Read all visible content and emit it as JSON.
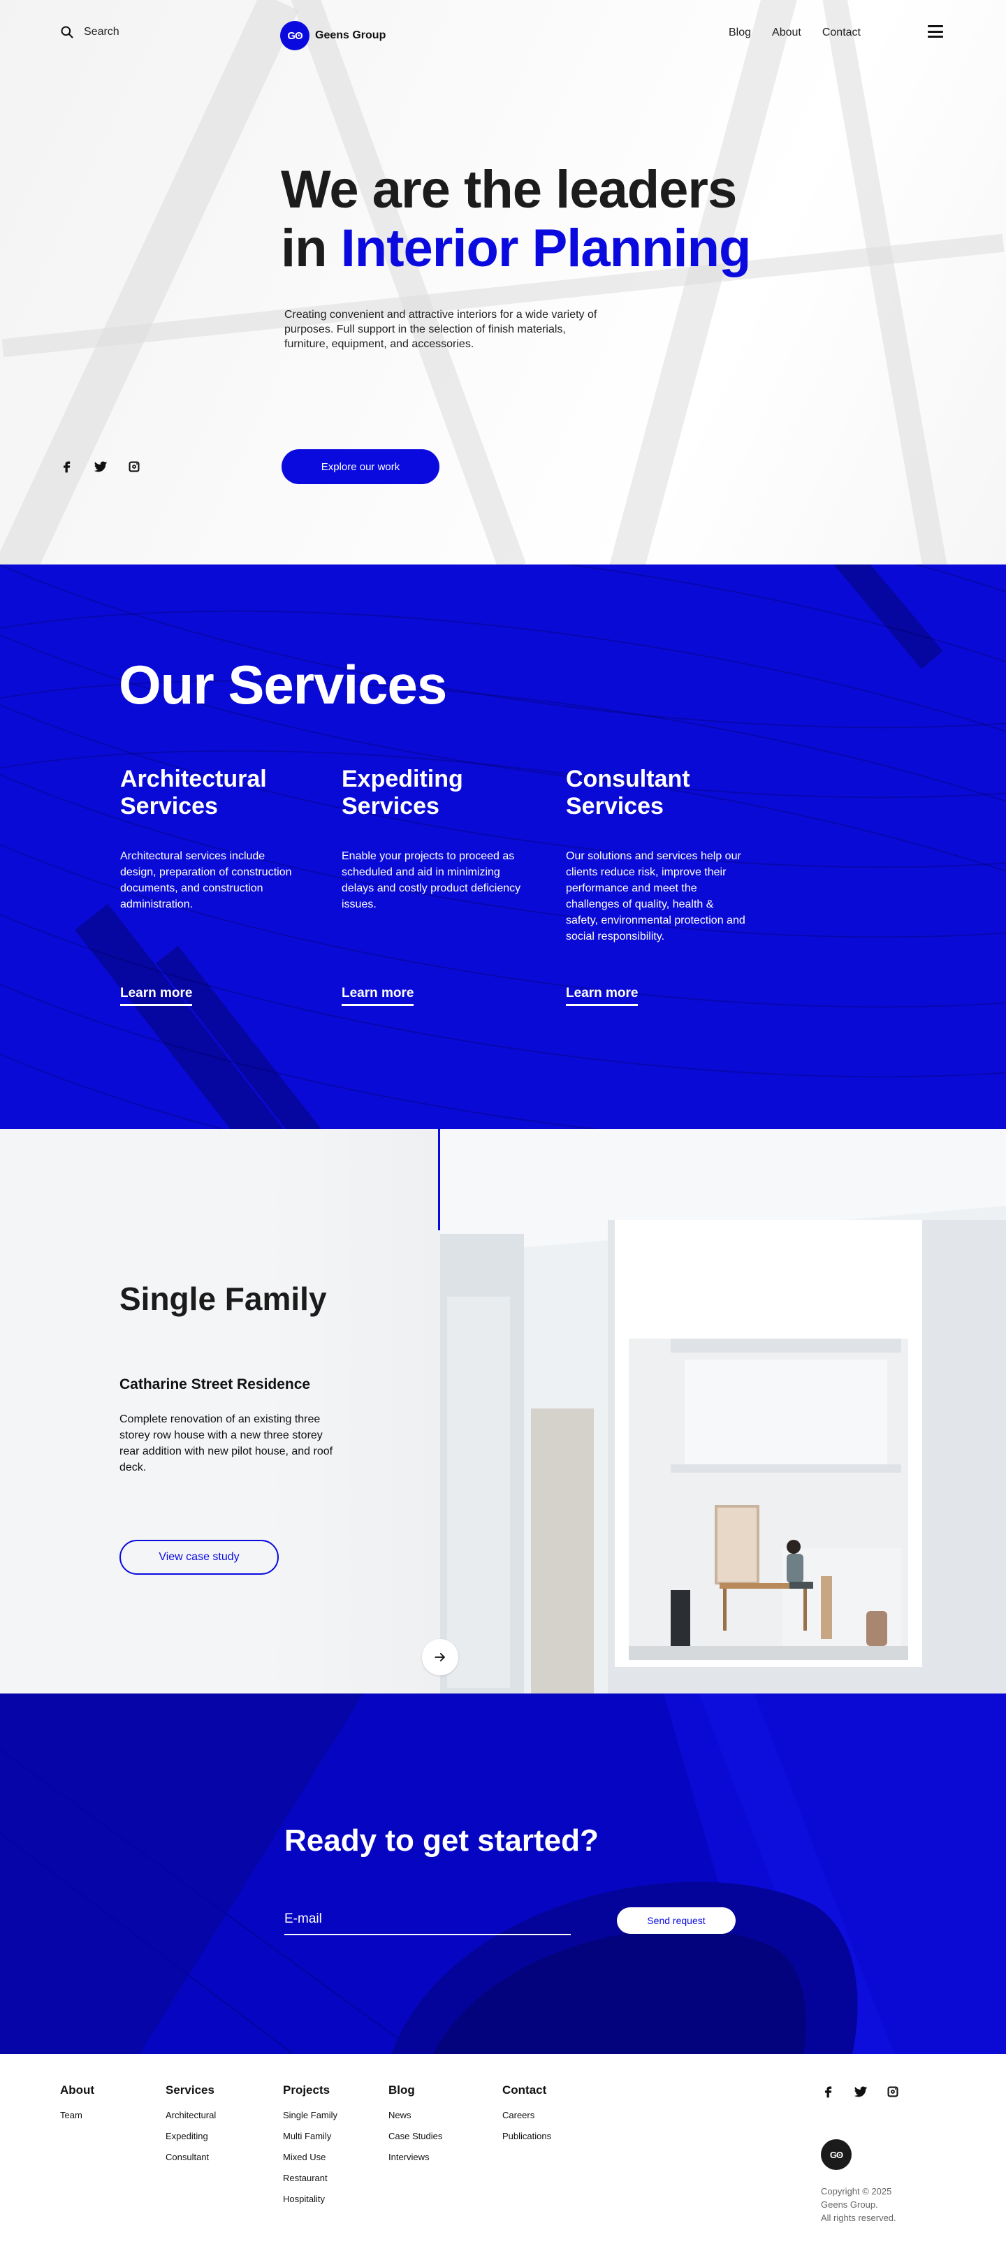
{
  "header": {
    "search_label": "Search",
    "brand_logo": "Gʘ",
    "brand_name": "Geens Group",
    "nav": [
      "Blog",
      "About",
      "Contact"
    ],
    "menu_icon": "hamburger-icon"
  },
  "hero": {
    "title_line1": "We are the leaders",
    "title_line2_prefix": "in ",
    "title_line2_accent": "Interior Planning",
    "description": "Creating convenient and attractive interiors for a wide variety of purposes. Full support in the selection of finish materials, furniture, equipment, and accessories.",
    "cta_label": "Explore our work",
    "socials": [
      "facebook-icon",
      "twitter-icon",
      "instagram-icon"
    ]
  },
  "services": {
    "title": "Our Services",
    "items": [
      {
        "title": "Architectural Services",
        "description": "Architectural services include design, preparation of construction documents, and construction administration.",
        "link": "Learn more"
      },
      {
        "title": "Expediting Services",
        "description": "Enable your projects to proceed as scheduled and aid in minimizing delays and costly product deficiency issues.",
        "link": "Learn more"
      },
      {
        "title": "Consultant Services",
        "description": "Our solutions and services help our clients reduce risk, improve their performance and meet the challenges of quality, health & safety, environmental protection and social responsibility.",
        "link": "Learn more"
      }
    ]
  },
  "project": {
    "category": "Single Family",
    "name": "Catharine Street Residence",
    "description": "Complete renovation of an existing three storey row house with a new three storey rear addition with new pilot house, and roof deck.",
    "cta_label": "View case study",
    "next_icon": "arrow-right-icon"
  },
  "cta": {
    "title": "Ready to get started?",
    "email_placeholder": "E-mail",
    "button_label": "Send request"
  },
  "footer": {
    "columns": [
      {
        "heading": "About",
        "links": [
          "Team"
        ]
      },
      {
        "heading": "Services",
        "links": [
          "Architectural",
          "Expediting",
          "Consultant"
        ]
      },
      {
        "heading": "Projects",
        "links": [
          "Single Family",
          "Multi Family",
          "Mixed Use",
          "Restaurant",
          "Hospitality"
        ]
      },
      {
        "heading": "Blog",
        "links": [
          "News",
          "Case Studies",
          "Interviews"
        ]
      },
      {
        "heading": "Contact",
        "links": [
          "Careers",
          "Publications"
        ]
      }
    ],
    "logo": "Gʘ",
    "copyright": [
      "Copyright © 2025",
      "Geens Group.",
      "All rights reserved."
    ]
  },
  "colors": {
    "accent": "#0a0adf",
    "text": "#1c1c1c"
  }
}
